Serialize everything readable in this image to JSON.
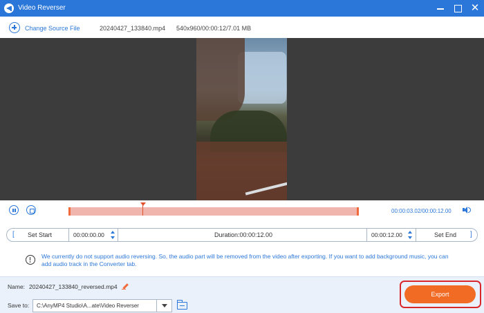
{
  "window": {
    "title": "Video Reverser",
    "close_glyph": "✕"
  },
  "source": {
    "change_label": "Change Source File",
    "file_name": "20240427_133840.mp4",
    "file_info": "540x960/00:00:12/7.01 MB"
  },
  "player": {
    "time_readout": "00:00:03.02/00:00:12.00",
    "progress": 0.25
  },
  "trim": {
    "set_start_label": "Set Start",
    "start_time": "00:00:00.00",
    "duration": "Duration:00:00:12.00",
    "end_time": "00:00:12.00",
    "set_end_label": "Set End",
    "bracket_left": "[",
    "bracket_right": "]"
  },
  "notice": {
    "text": "We currently do not support audio reversing. So, the audio part will be removed from the video after exporting. If you want to add background music, you can add audio track in the Converter tab."
  },
  "output": {
    "name_label": "Name:",
    "name_value": "20240427_133840_reversed.mp4",
    "save_label": "Save to:",
    "save_path": "C:\\AnyMP4 Studio\\A...ate\\Video Reverser",
    "export_label": "Export"
  },
  "icons": {
    "app": "video-reverser-icon",
    "add": "plus-circle-icon",
    "pause": "pause-icon",
    "stop": "stop-icon",
    "volume": "speaker-icon",
    "notice": "info-icon",
    "edit": "pencil-icon",
    "folder": "folder-icon"
  },
  "colors": {
    "accent": "#2b77d9",
    "export": "#f26b25",
    "highlight": "#d9262b",
    "timeline": "#f0b6ae"
  }
}
